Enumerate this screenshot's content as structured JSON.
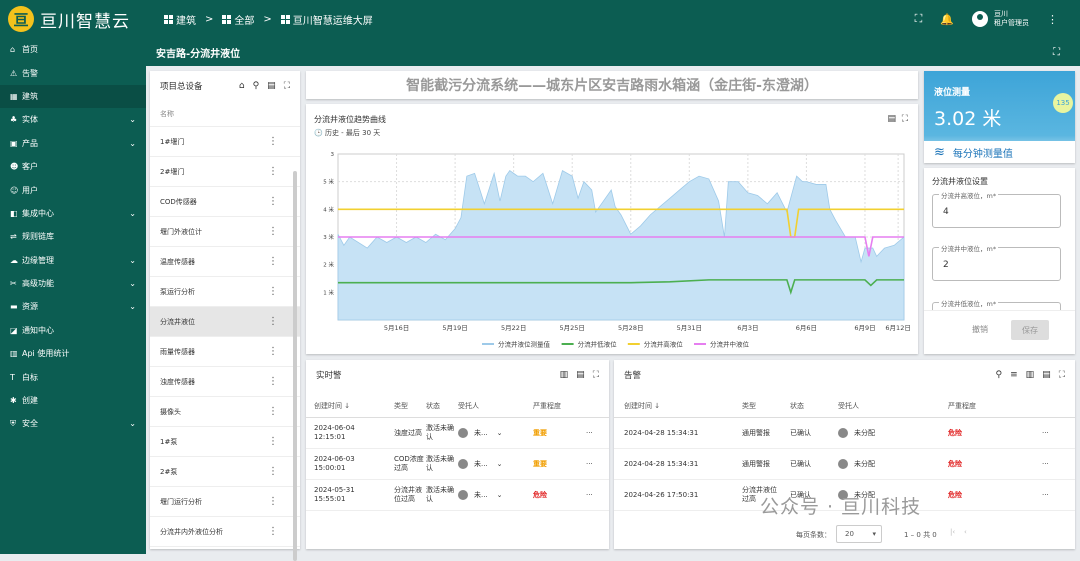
{
  "app": {
    "name": "亘川智慧云",
    "logo_letter": "亘"
  },
  "breadcrumbs": [
    "建筑",
    "全部",
    "亘川智慧运维大屏"
  ],
  "user": {
    "name": "亘川",
    "role": "租户管理员"
  },
  "page_title": "安吉路-分流井液位",
  "sidebar": [
    {
      "label": "首页",
      "icon": "home-icon",
      "glyph": "⌂",
      "chevron": false
    },
    {
      "label": "告警",
      "icon": "warning-icon",
      "glyph": "⚠",
      "chevron": false
    },
    {
      "label": "建筑",
      "icon": "grid-icon",
      "glyph": "▦",
      "chevron": false,
      "active": true
    },
    {
      "label": "实体",
      "icon": "entity-icon",
      "glyph": "♣",
      "chevron": true
    },
    {
      "label": "产品",
      "icon": "product-icon",
      "glyph": "▣",
      "chevron": true
    },
    {
      "label": "客户",
      "icon": "customers-icon",
      "glyph": "☻",
      "chevron": false
    },
    {
      "label": "用户",
      "icon": "user-icon",
      "glyph": "☺",
      "chevron": false
    },
    {
      "label": "集成中心",
      "icon": "integration-icon",
      "glyph": "◧",
      "chevron": true
    },
    {
      "label": "规则链库",
      "icon": "rule-chain-icon",
      "glyph": "⇌",
      "chevron": false
    },
    {
      "label": "边缘管理",
      "icon": "edge-icon",
      "glyph": "☁",
      "chevron": true
    },
    {
      "label": "高级功能",
      "icon": "advanced-icon",
      "glyph": "✂",
      "chevron": true
    },
    {
      "label": "资源",
      "icon": "folder-icon",
      "glyph": "▬",
      "chevron": true
    },
    {
      "label": "通知中心",
      "icon": "notification-icon",
      "glyph": "◪",
      "chevron": false
    },
    {
      "label": "Api 使用统计",
      "icon": "stats-icon",
      "glyph": "▥",
      "chevron": false
    },
    {
      "label": "白标",
      "icon": "format-icon",
      "glyph": "T",
      "chevron": false
    },
    {
      "label": "创建",
      "icon": "settings-icon",
      "glyph": "✱",
      "chevron": false
    },
    {
      "label": "安全",
      "icon": "security-icon",
      "glyph": "⛨",
      "chevron": true
    }
  ],
  "device_list": {
    "title": "项目总设备",
    "column": "名称",
    "items": [
      "1#堰门",
      "2#堰门",
      "COD传感器",
      "堰门外液位计",
      "温度传感器",
      "泵运行分析",
      "分流井液位",
      "雨量传感器",
      "浊度传感器",
      "摄像头",
      "1#泵",
      "2#泵",
      "堰门运行分析",
      "分流井内外液位分析"
    ],
    "selected": "分流井液位"
  },
  "banner": "智能截污分流系统——城东片区安吉路雨水箱涵（金庄街-东澄湖）",
  "chart_card": {
    "title": "分流井液位趋势曲线",
    "subtitle": "历史 - 最后 30 天"
  },
  "chart_data": {
    "type": "line",
    "x_ticks": [
      "5月16日",
      "5月19日",
      "5月22日",
      "5月25日",
      "5月28日",
      "5月31日",
      "6月3日",
      "6月6日",
      "6月9日",
      "6月12日"
    ],
    "y_ticks": [
      "1 米",
      "2 米",
      "3 米",
      "4 米",
      "5 米"
    ],
    "y_top_label": "3",
    "ylim": [
      0,
      6
    ],
    "series": [
      {
        "name": "分流井液位测量值",
        "color": "#9ecae9",
        "kind": "area",
        "x": [
          13.0,
          13.3,
          13.6,
          14.5,
          15.0,
          15.5,
          16.0,
          16.5,
          17.0,
          17.5,
          18.0,
          18.5,
          19.0,
          19.3,
          19.6,
          20.0,
          20.5,
          21.0,
          21.3,
          21.6,
          21.8,
          22.0,
          22.2,
          22.6,
          23.0,
          23.5,
          24.0,
          24.5,
          25.0,
          25.3,
          25.6,
          26.0,
          26.2,
          26.5,
          27.0,
          27.2,
          27.5,
          28.0,
          28.5,
          29.0,
          29.5,
          30.0,
          30.5,
          31.0,
          31.5,
          32.0,
          32.5,
          32.8,
          33.0,
          33.5,
          34.0,
          34.5,
          35.0,
          35.5,
          36.0,
          36.5,
          36.8,
          37.0,
          37.5,
          38.0,
          38.2,
          38.5,
          39.0,
          39.5,
          39.8,
          40.0,
          40.4,
          40.6,
          41.0,
          41.5,
          42.0
        ],
        "y": [
          3.1,
          2.7,
          3.0,
          2.6,
          3.0,
          2.8,
          3.0,
          2.8,
          3.0,
          2.8,
          3.1,
          2.9,
          3.3,
          3.7,
          5.2,
          5.3,
          4.2,
          5.3,
          4.3,
          5.2,
          5.4,
          5.3,
          5.2,
          5.2,
          5.0,
          5.3,
          4.2,
          5.4,
          5.2,
          4.4,
          5.0,
          4.7,
          3.9,
          4.2,
          4.7,
          4.1,
          3.8,
          3.1,
          3.4,
          3.8,
          4.1,
          4.4,
          4.7,
          5.0,
          5.2,
          5.1,
          4.3,
          3.0,
          5.0,
          5.0,
          4.6,
          4.5,
          4.2,
          4.6,
          3.9,
          5.2,
          5.0,
          5.0,
          4.9,
          4.9,
          4.0,
          3.6,
          3.0,
          3.0,
          2.1,
          2.6,
          2.6,
          2.3,
          2.6,
          2.7,
          3.0
        ]
      },
      {
        "name": "分流井低液位",
        "color": "#4caf50",
        "kind": "line",
        "x": [
          13,
          20,
          25,
          28,
          30,
          32,
          33,
          35,
          36,
          36.2,
          36.4,
          37,
          40,
          40.3,
          40.6,
          42
        ],
        "y": [
          1.35,
          1.35,
          1.35,
          1.35,
          1.38,
          1.45,
          1.45,
          1.45,
          1.45,
          1.0,
          1.45,
          1.45,
          1.45,
          1.25,
          1.45,
          1.45
        ]
      },
      {
        "name": "分流井高液位",
        "color": "#f2d030",
        "kind": "line",
        "x": [
          13,
          36,
          36.2,
          36.4,
          36.6,
          42
        ],
        "y": [
          4.0,
          4.0,
          3.0,
          3.0,
          4.0,
          4.0
        ]
      },
      {
        "name": "分流井中液位",
        "color": "#e67ef0",
        "kind": "line",
        "x": [
          13,
          40,
          40.2,
          40.4,
          42
        ],
        "y": [
          3.0,
          3.0,
          2.3,
          3.0,
          3.0
        ]
      }
    ],
    "legend": "bottom"
  },
  "level_card": {
    "title": "液位测量",
    "value": "3.02 米",
    "badge": "135",
    "footer": "每分钟测量值"
  },
  "settings_card": {
    "title": "分流井液位设置",
    "fields": [
      {
        "label": "分流井高液位，m*",
        "value": "4"
      },
      {
        "label": "分流井中液位，m*",
        "value": "2"
      },
      {
        "label": "分流井低液位，m*",
        "value": ""
      }
    ],
    "cancel": "撤销",
    "save": "保存"
  },
  "realtime_alarms": {
    "title": "实时警",
    "headers": [
      "创建时间",
      "类型",
      "状态",
      "受托人",
      "严重程度"
    ],
    "rows": [
      {
        "time": "2024-06-04 12:15:01",
        "type": "浊度过高",
        "status": "激活未确认",
        "assignee": "未...",
        "severity": "重要",
        "sev": "orange"
      },
      {
        "time": "2024-06-03 15:00:01",
        "type": "COD浓度过高",
        "status": "激活未确认",
        "assignee": "未...",
        "severity": "重要",
        "sev": "orange"
      },
      {
        "time": "2024-05-31 15:55:01",
        "type": "分流井液位过高",
        "status": "激活未确认",
        "assignee": "未...",
        "severity": "危险",
        "sev": "red"
      }
    ]
  },
  "alarms": {
    "title": "告警",
    "headers": [
      "创建时间",
      "类型",
      "状态",
      "受托人",
      "严重程度"
    ],
    "rows": [
      {
        "time": "2024-04-28 15:34:31",
        "type": "通用警报",
        "status": "已确认",
        "assignee": "未分配",
        "severity": "危险"
      },
      {
        "time": "2024-04-28 15:34:31",
        "type": "通用警报",
        "status": "已确认",
        "assignee": "未分配",
        "severity": "危险"
      },
      {
        "time": "2024-04-26 17:50:31",
        "type": "分流井液位过高",
        "status": "已确认",
        "assignee": "未分配",
        "severity": "危险"
      }
    ],
    "pager": {
      "page_size_label": "每页条数：",
      "page_size": "20",
      "range": "1 – 0 共 0"
    }
  },
  "watermark": "公众号 · 亘川科技"
}
